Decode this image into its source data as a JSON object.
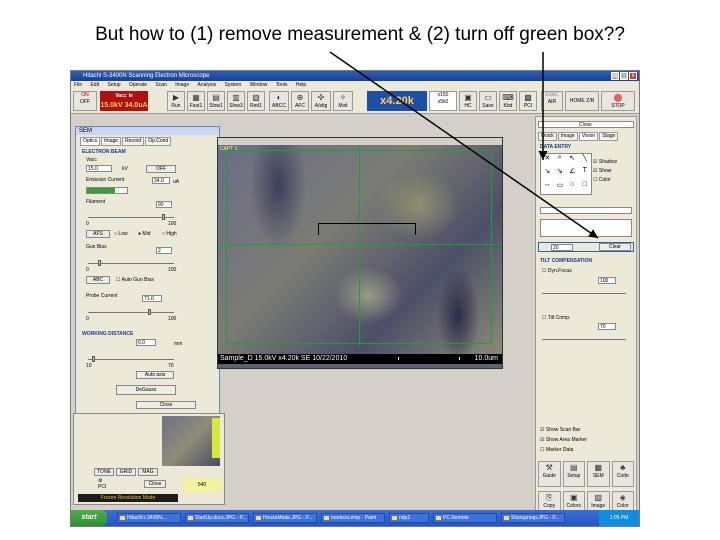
{
  "caption": "But how to (1) remove measurement & (2) turn off green box??",
  "window": {
    "title": "Hitachi S-3400N Scanning Electron Microscope",
    "min": "_",
    "max": "□",
    "close": "x"
  },
  "menu": [
    "File",
    "Edit",
    "Setup",
    "Operate",
    "Scan",
    "Image",
    "Analysis",
    "System",
    "Window",
    "Tools",
    "Help"
  ],
  "toolbar": {
    "on": "ON",
    "off": "OFF",
    "vacc_label": "Vacc",
    "ie_label": "Ie",
    "vacc_value": "15.0kV",
    "ie_value": "34.0uA",
    "buttons": [
      {
        "label": "Run",
        "icon": "play-icon"
      },
      {
        "label": "Fast1",
        "icon": "fast-icon"
      },
      {
        "label": "Slow1",
        "icon": "slow-icon"
      },
      {
        "label": "Slow3",
        "icon": "slow3-icon"
      },
      {
        "label": "Red1",
        "icon": "red-icon"
      },
      {
        "label": "ABCC",
        "icon": "abcc-icon"
      },
      {
        "label": "AFC",
        "icon": "afc-icon"
      },
      {
        "label": "A/stig",
        "icon": "astig-icon"
      },
      {
        "label": "Mvit",
        "icon": "mvit-icon"
      }
    ],
    "mag_value": "x4.20k",
    "mag_box_top": "x150",
    "mag_box_bottom": "x5k0",
    "right_buttons": [
      "HC",
      "Save",
      "Kbd",
      "PCI"
    ],
    "evac": "EVAC",
    "air": "AIR",
    "home": "HOME Z/R",
    "stop": "STOP"
  },
  "sem_panel": {
    "title": "SEM",
    "tabs": [
      "Optics",
      "Image",
      "Record",
      "Op.Cond"
    ],
    "electron_beam": "ELECTRON BEAM",
    "vacc_label": "Vacc",
    "vacc_value": "15.0",
    "vacc_unit": "kV",
    "off_btn": "OFF",
    "emission_label": "Emission Current",
    "emission_value": "34.0",
    "emission_unit": "uA",
    "filament_label": "Filament",
    "filament_value": "90",
    "min0": "0",
    "max100": "100",
    "afs_btn": "AFS",
    "low": "Low",
    "mid": "Mid",
    "high": "High",
    "gun_bias_label": "Gun Bias",
    "gun_bias_value": "2",
    "abc_btn": "ABC",
    "auto_bias": "Auto Gun Bias",
    "probe_label": "Probe Current",
    "probe_value": "71.0",
    "working_distance": "WORKING DISTANCE",
    "wd_value": "6.0",
    "wd_unit": "mm",
    "wd_min": "10",
    "wd_max": "70",
    "auto_axis": "Auto axis",
    "degauss": "DeGauss",
    "close": "Close"
  },
  "image_window": {
    "label": "CAPT 1",
    "status": "Sample_D 15.0kV x4.20k SE 10/22/2010",
    "scale": "10.0um"
  },
  "right_panel": {
    "tabs_top": [
      "Quick",
      "Image",
      "Vision",
      "Stage"
    ],
    "close": "Close",
    "data_entry": "DATA ENTRY",
    "shadow": "Shadow",
    "show": "Show",
    "color": "Color",
    "clear": "Clear",
    "value": "20",
    "tilt": "TILT COMPENSATION",
    "dyn_focus": "Dyn.Focus",
    "dyn_value": "100",
    "tilt_comp": "Tilt Comp.",
    "tilt_value": "70",
    "show_scan_bar": "Show Scan Bar",
    "show_area_marker": "Show Area Marker",
    "marker_data": "Marker Data",
    "bottom_buttons": [
      "Guide",
      "Setup",
      "SEM",
      "Code",
      "Copy",
      "Colors",
      "Image",
      "Color"
    ]
  },
  "small_window": {
    "buttons": [
      "TONE",
      "GRID",
      "MAG"
    ],
    "pci": "PCI",
    "close": "Close",
    "value": "540",
    "status": "Frozen Revolution Mode"
  },
  "taskbar": {
    "start": "start",
    "items": [
      "Hitachi's 3400N...",
      "StartUp.docx.JPG - P...",
      "HouseMode.JPG - P...",
      "markers.emp - Paint",
      "ndp2",
      "PC Remote",
      "Startupmap.JPG - P..."
    ],
    "clock": "1:05 PM"
  },
  "arrow_color": "#000000"
}
